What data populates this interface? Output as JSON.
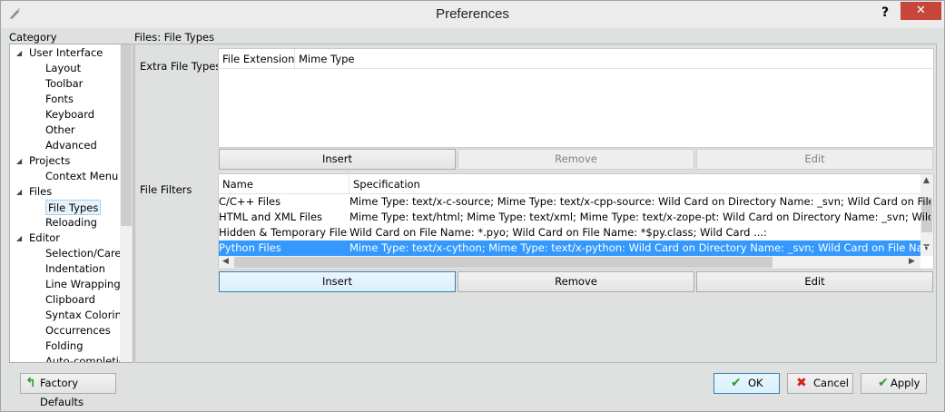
{
  "window": {
    "title": "Preferences",
    "help": "?",
    "close": "✕"
  },
  "category": {
    "label": "Category",
    "tree": [
      {
        "label": "User Interface",
        "level": 0,
        "expanded": true
      },
      {
        "label": "Layout",
        "level": 1
      },
      {
        "label": "Toolbar",
        "level": 1
      },
      {
        "label": "Fonts",
        "level": 1
      },
      {
        "label": "Keyboard",
        "level": 1
      },
      {
        "label": "Other",
        "level": 1
      },
      {
        "label": "Advanced",
        "level": 1
      },
      {
        "label": "Projects",
        "level": 0,
        "expanded": true
      },
      {
        "label": "Context Menu",
        "level": 1
      },
      {
        "label": "Files",
        "level": 0,
        "expanded": true
      },
      {
        "label": "File Types",
        "level": 1,
        "selected": true
      },
      {
        "label": "Reloading",
        "level": 1
      },
      {
        "label": "Editor",
        "level": 0,
        "expanded": true
      },
      {
        "label": "Selection/Caret",
        "level": 1
      },
      {
        "label": "Indentation",
        "level": 1
      },
      {
        "label": "Line Wrapping",
        "level": 1
      },
      {
        "label": "Clipboard",
        "level": 1
      },
      {
        "label": "Syntax Coloring",
        "level": 1
      },
      {
        "label": "Occurrences",
        "level": 1
      },
      {
        "label": "Folding",
        "level": 1
      },
      {
        "label": "Auto-completion",
        "level": 1
      }
    ]
  },
  "page": {
    "title": "Files: File Types",
    "extra": {
      "label": "Extra File Types",
      "columns": [
        "File Extension",
        "Mime Type"
      ],
      "buttons": {
        "insert": "Insert",
        "remove": "Remove",
        "edit": "Edit"
      }
    },
    "filters": {
      "label": "File Filters",
      "columns": [
        "Name",
        "Specification"
      ],
      "rows": [
        {
          "name": "C/C++ Files",
          "spec": "Mime Type: text/x-c-source; Mime Type: text/x-cpp-source: Wild Card on Directory Name: _svn; Wild Card on File Name: *~;"
        },
        {
          "name": "HTML and XML Files",
          "spec": "Mime Type: text/html; Mime Type: text/xml; Mime Type: text/x-zope-pt: Wild Card on Directory Name: _svn; Wild Card on File Name: *~;"
        },
        {
          "name": "Hidden & Temporary Files",
          "spec": "Wild Card on File Name: *.pyo; Wild Card on File Name: *$py.class; Wild Card ...:"
        },
        {
          "name": "Python Files",
          "spec": "Mime Type: text/x-cython; Mime Type: text/x-python: Wild Card on Directory Name: _svn; Wild Card on File Name: *~; Wild",
          "selected": true
        }
      ],
      "buttons": {
        "insert": "Insert",
        "remove": "Remove",
        "edit": "Edit"
      }
    }
  },
  "footer": {
    "factory": "Factory Defaults",
    "ok": "OK",
    "cancel": "Cancel",
    "apply": "Apply"
  },
  "colors": {
    "selection": "#3399ff",
    "close": "#c7463c",
    "ok_green": "#2e9b2e",
    "cancel_red": "#d02020"
  }
}
